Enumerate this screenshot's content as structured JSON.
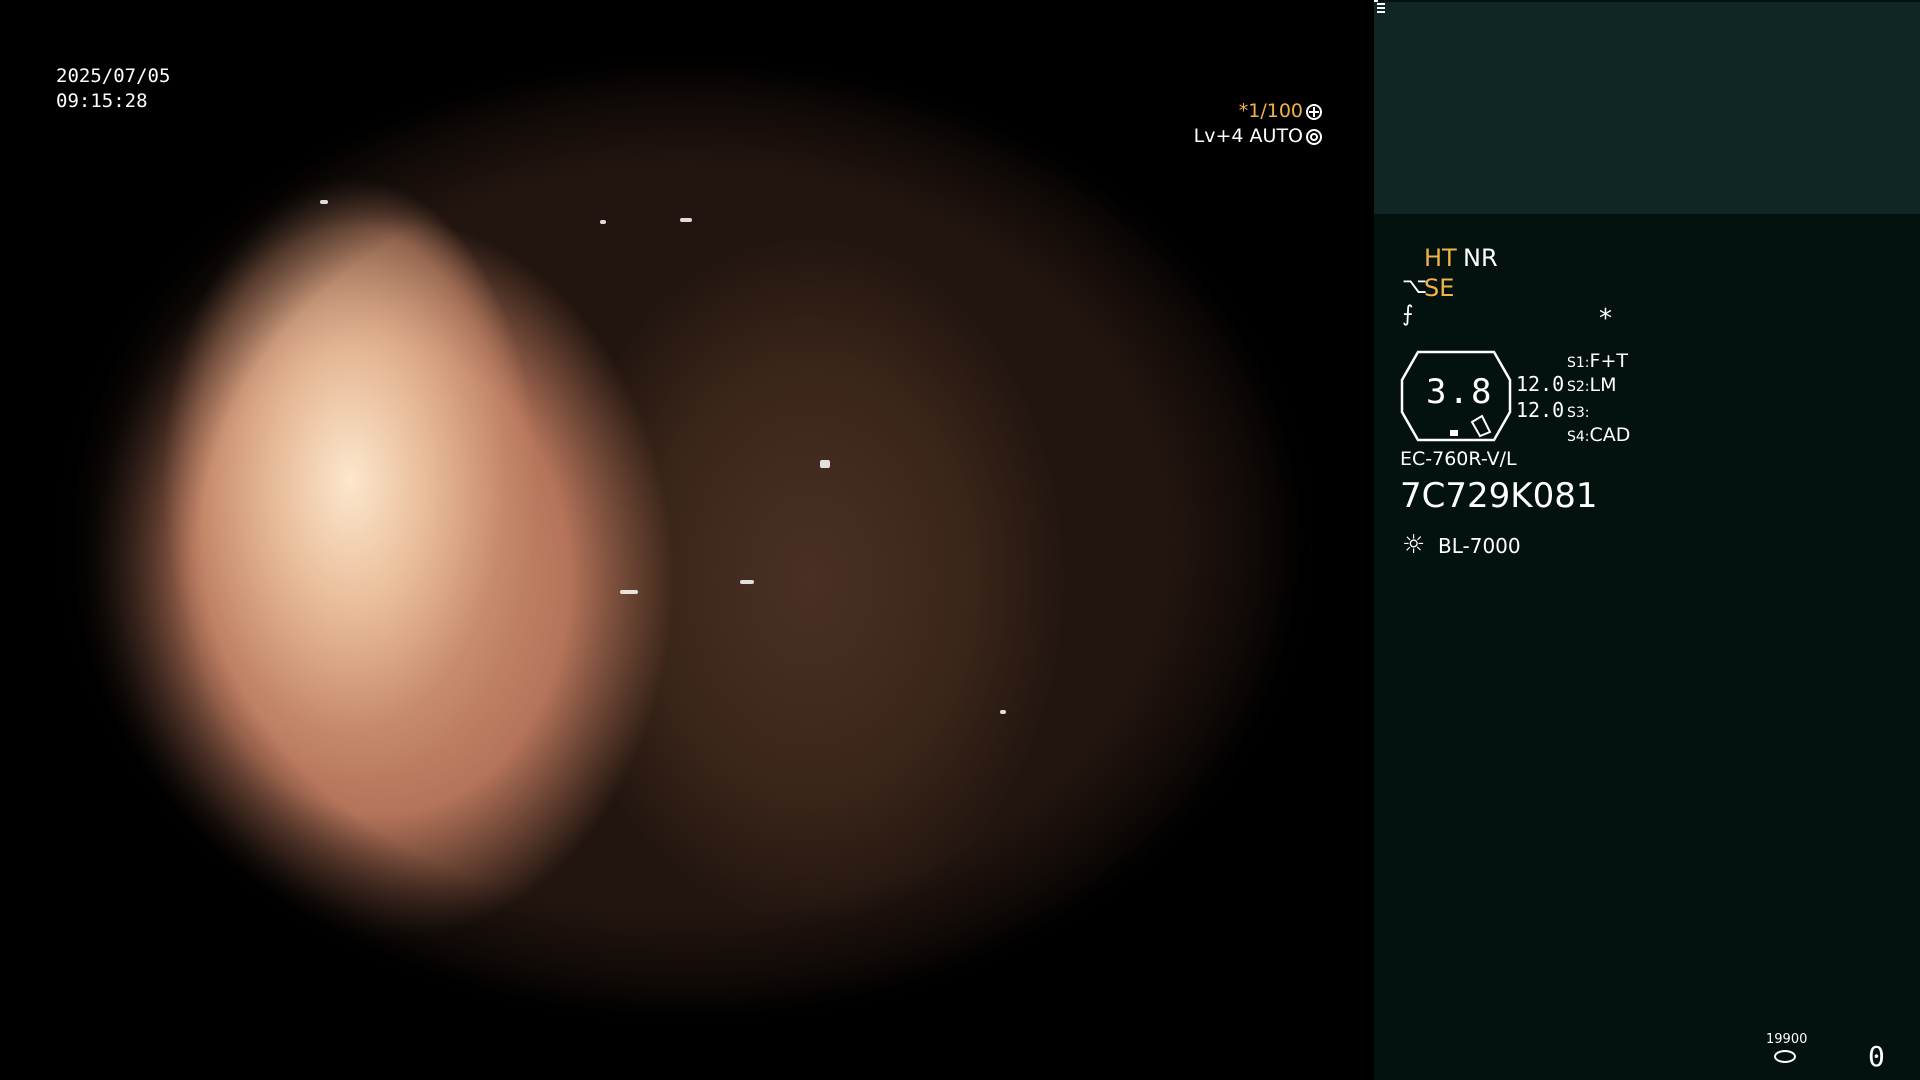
{
  "overlay": {
    "date": "2025/07/05",
    "time": "09:15:28",
    "shutter_asterisk": "*",
    "shutter_speed": "1/100",
    "level_mode": "Lv+4 AUTO",
    "shutter_icon": "aperture-icon",
    "level_icon": "iris-icon"
  },
  "panel": {
    "ht": "HT",
    "nr": "NR",
    "se_icon": "⌥",
    "se": "SE",
    "f_icon": "⨍",
    "asterisk": "*",
    "zoom_value": "3.8",
    "value1": "12.0",
    "value2": "12.0",
    "s1_key": "S1:",
    "s1_value": "F+T",
    "s2_key": "S2:",
    "s2_value": "LM",
    "s3_key": "S3:",
    "s3_value": "",
    "s4_key": "S4:",
    "s4_value": "CAD",
    "model": "EC-760R-V/L",
    "serial": "7C729K081",
    "light_icon": "☼",
    "light_source": "BL-7000",
    "counter_small": "19900",
    "counter_big": "0",
    "colors": {
      "accent": "#f2b24a",
      "panel_bg": "#03110f",
      "thumb_bg": "#0f2624"
    }
  }
}
